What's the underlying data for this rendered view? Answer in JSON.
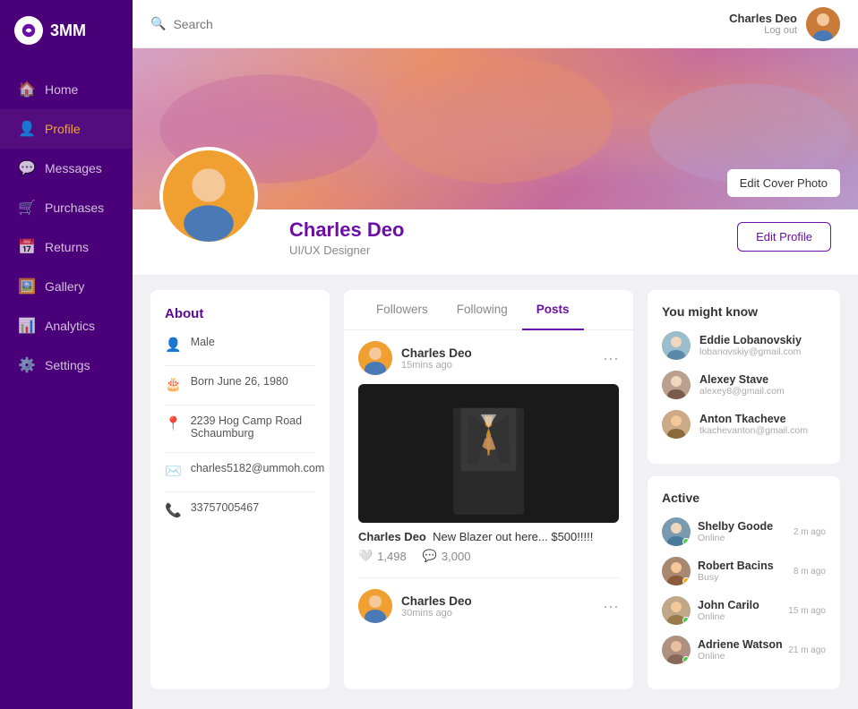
{
  "app": {
    "name": "3MM",
    "search_placeholder": "Search"
  },
  "topbar": {
    "username": "Charles Deo",
    "logout_label": "Log out"
  },
  "sidebar": {
    "items": [
      {
        "id": "home",
        "label": "Home",
        "icon": "🏠"
      },
      {
        "id": "profile",
        "label": "Profile",
        "icon": "👤",
        "active": true
      },
      {
        "id": "messages",
        "label": "Messages",
        "icon": "💬"
      },
      {
        "id": "purchases",
        "label": "Purchases",
        "icon": "🛒"
      },
      {
        "id": "returns",
        "label": "Returns",
        "icon": "📅"
      },
      {
        "id": "gallery",
        "label": "Gallery",
        "icon": "🖼️"
      },
      {
        "id": "analytics",
        "label": "Analytics",
        "icon": "📊"
      },
      {
        "id": "settings",
        "label": "Settings",
        "icon": "⚙️"
      }
    ]
  },
  "cover": {
    "edit_label": "Edit Cover Photo"
  },
  "profile": {
    "name": "Charles Deo",
    "title": "UI/UX Designer",
    "edit_label": "Edit Profile"
  },
  "about": {
    "title": "About",
    "gender": "Male",
    "birthday": "Born June 26, 1980",
    "address": "2239  Hog Camp Road Schaumburg",
    "email": "charles5182@ummoh.com",
    "phone": "33757005467"
  },
  "tabs": {
    "followers": "Followers",
    "following": "Following",
    "posts": "Posts"
  },
  "posts": [
    {
      "author": "Charles Deo",
      "time": "15mins ago",
      "has_image": true,
      "caption": "New Blazer out here... $500!!!!!",
      "likes": "1,498",
      "comments": "3,000"
    },
    {
      "author": "Charles Deo",
      "time": "30mins ago",
      "has_image": false,
      "caption": "",
      "likes": "",
      "comments": ""
    }
  ],
  "you_might_know": {
    "title": "You might know",
    "people": [
      {
        "name": "Eddie Lobanovskiy",
        "email": "lobanovskiy@gmail.com"
      },
      {
        "name": "Alexey Stave",
        "email": "alexey8@gmail.com"
      },
      {
        "name": "Anton Tkacheve",
        "email": "tkachevanton@gmail.com"
      }
    ]
  },
  "active": {
    "title": "Active",
    "people": [
      {
        "name": "Shelby Goode",
        "status": "Online",
        "time": "2 m ago",
        "dot": "online"
      },
      {
        "name": "Robert Bacins",
        "status": "Busy",
        "time": "8 m ago",
        "dot": "busy"
      },
      {
        "name": "John Carilo",
        "status": "Online",
        "time": "15 m ago",
        "dot": "online"
      },
      {
        "name": "Adriene Watson",
        "status": "Online",
        "time": "21 m ago",
        "dot": "online"
      }
    ]
  }
}
